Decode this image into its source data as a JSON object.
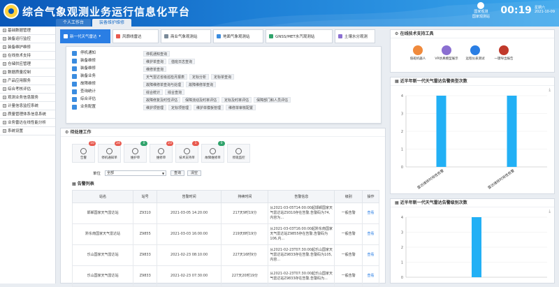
{
  "header": {
    "title": "综合气象观测业务运行信息化平台",
    "nav_tabs": [
      "个人工作台",
      "装备维护维修"
    ],
    "user_name": "国家观测站",
    "user_sub": "国家观测",
    "clock": "00:19",
    "weekday": "星期六",
    "date": "2021-10-09"
  },
  "sidebar": {
    "items": [
      "基础数据管理",
      "装备运行监控",
      "装备维护维修",
      "在线技术支持",
      "仓储供应管理",
      "数据质量控制",
      "产品应用服务",
      "综合考核评估",
      "观测业务信息服务",
      "计量信息监控系统",
      "质量管理体系信息系统",
      "业务雷达在线性能分析",
      "系统设置"
    ]
  },
  "systems": [
    {
      "label": "新一代天气雷达",
      "color": "#ffffff"
    },
    {
      "label": "风廓线雷达",
      "color": "#e85a4f"
    },
    {
      "label": "商业气象观测站",
      "color": "#7a8a99"
    },
    {
      "label": "地面气象观测站",
      "color": "#3a8ce0"
    },
    {
      "label": "GNSS/MET水汽观测站",
      "color": "#2fa36b"
    },
    {
      "label": "土壤水分观测",
      "color": "#8b6fd1"
    }
  ],
  "menu": {
    "left": [
      "停机通知",
      "装备维修",
      "装备维修",
      "装备业务",
      "故障维修",
      "查询统计",
      "综合评估",
      "业务配置"
    ],
    "rows": [
      [
        "停机通知查询"
      ],
      [
        "维护单查询",
        "值班日志查询"
      ],
      [
        "维修单查询"
      ],
      [
        "天气雷达省级巡检月报表",
        "定标分析",
        "定标单查询"
      ],
      [
        "故障维修单查询与处理",
        "故障维修单查询"
      ],
      [
        "综合统计",
        "综合查询"
      ],
      [
        "故障修复及时性评估",
        "保障流动及时率评估",
        "定标及时率评估",
        "保障部门和人员评估"
      ],
      [
        "维护项管理",
        "定标项管理",
        "维护单模板管理",
        "维修单审核配置"
      ]
    ]
  },
  "todo": {
    "title": "待处理工作",
    "cards": [
      {
        "label": "告警",
        "count": "10",
        "badge_color": "#e85a4f"
      },
      {
        "label": "停机通知单",
        "count": "24",
        "badge_color": "#e85a4f"
      },
      {
        "label": "维护单",
        "count": "0",
        "badge_color": "#2fa36b"
      },
      {
        "label": "维修单",
        "count": "23",
        "badge_color": "#e85a4f"
      },
      {
        "label": "技术支持单",
        "count": "1",
        "badge_color": "#e85a4f"
      },
      {
        "label": "故障维修单",
        "count": "0",
        "badge_color": "#2fa36b"
      },
      {
        "label": "停观监控",
        "count": "",
        "badge_color": ""
      }
    ],
    "filter_label": "单位",
    "filter_value": "全部",
    "query_btn": "查询",
    "clear_btn": "清空",
    "alarm_title": "告警列表",
    "columns": [
      "站名",
      "站号",
      "告警时间",
      "持续时间",
      "告警信息",
      "级别",
      "操作"
    ],
    "rows": [
      {
        "name": "邯郸国家天气雷达站",
        "id": "Z9310",
        "time": "2021-03-05 14:20:00",
        "dur": "217天9时19分",
        "info": "从2021-03-05T14:00:00起邯郸国家天气雷达站Z9310存在告警,告警码为74,内容为...",
        "level": "一般告警",
        "op": "查看"
      },
      {
        "name": "黔东南国家天气雷达站",
        "id": "Z9855",
        "time": "2021-03-03 16:00:00",
        "dur": "219天8时19分",
        "info": "从2021-03-03T16:00:00起黔东南国家天气雷达站Z9855存在告警,告警码为106,内...",
        "level": "一般告警",
        "op": "查看"
      },
      {
        "name": "乐山国家天气雷达站",
        "id": "Z9833",
        "time": "2021-02-23 08:10:00",
        "dur": "227天16时9分",
        "info": "从2021-02-23T07:30:00起乐山国家天气雷达站Z9833存在告警,告警码为105,内容...",
        "level": "一般告警",
        "op": "查看"
      },
      {
        "name": "乐山国家天气雷达站",
        "id": "Z9833",
        "time": "2021-02-23 07:30:00",
        "dur": "227天20时19分",
        "info": "从2021-02-23T07:30:00起乐山国家天气雷达站Z9833存在告警,告警码为...",
        "level": "一般告警",
        "op": "查看"
      }
    ]
  },
  "tools": {
    "title": "在线技术支持工具",
    "items": [
      {
        "label": "值班机器人",
        "color": "#f08a3c"
      },
      {
        "label": "VR仿真模型展示",
        "color": "#8b6fd1"
      },
      {
        "label": "远程仪表测试",
        "color": "#2a7ee4"
      },
      {
        "label": "一键导出报告",
        "color": "#c0392b"
      }
    ]
  },
  "chart_data": [
    {
      "type": "bar",
      "title": "近半年新一代天气雷达告警类型次数",
      "categories": [
        "雷达维修时效性告警",
        "雷达维修时效性告警"
      ],
      "values": [
        4,
        4
      ],
      "ylim": [
        0,
        4
      ],
      "color": "#22b0f5"
    },
    {
      "type": "bar",
      "title": "近半年新一代天气雷达告警级别次数",
      "categories": [
        "一般告警"
      ],
      "values": [
        4
      ],
      "ylim": [
        0,
        4
      ],
      "color": "#22b0f5"
    }
  ]
}
